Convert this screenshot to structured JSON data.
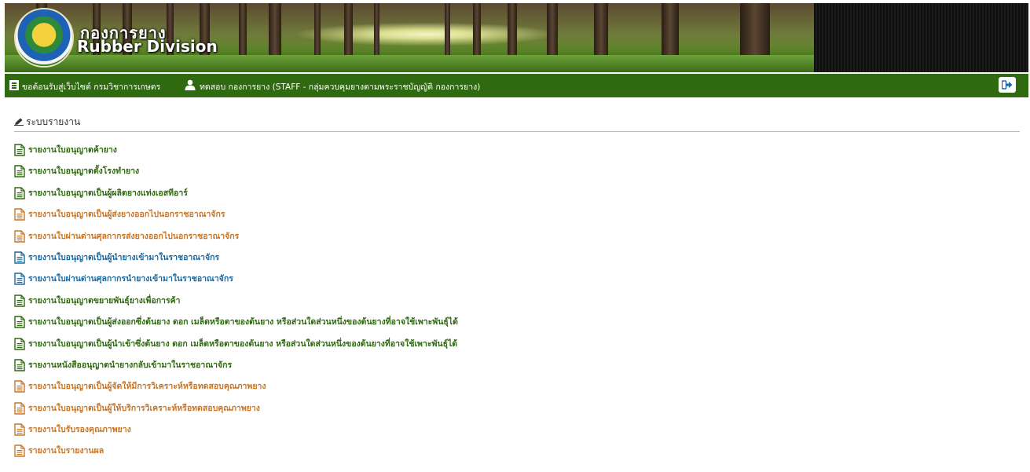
{
  "header": {
    "brand_th": "กองการยาง",
    "brand_en": "Rubber Division"
  },
  "userbar": {
    "welcome": "ขอต้อนรับสู่เว็บไซต์ กรมวิชาการเกษตร",
    "user": "ทดสอบ กองการยาง (STAFF - กลุ่มควบคุมยางตามพระราชบัญญัติ กองการยาง)",
    "icons": [
      "list-icon",
      "user-icon",
      "logout-icon"
    ]
  },
  "panel": {
    "title": "ระบบรายงาน",
    "icon": "pencil-icon"
  },
  "reports": [
    {
      "label": "รายงานใบอนุญาตค้ายาง",
      "color": "#2f6a10"
    },
    {
      "label": "รายงานใบอนุญาตตั้งโรงทำยาง",
      "color": "#2f6a10"
    },
    {
      "label": "รายงานใบอนุญาตเป็นผู้ผลิตยางแท่งเอสทีอาร์",
      "color": "#2f6a10"
    },
    {
      "label": "รายงานใบอนุญาตเป็นผู้ส่งยางออกไปนอกราชอาณาจักร",
      "color": "#c8772a"
    },
    {
      "label": "รายงานใบผ่านด่านศุลกากรส่งยางออกไปนอกราชอาณาจักร",
      "color": "#c8772a"
    },
    {
      "label": "รายงานใบอนุญาตเป็นผู้นำยางเข้ามาในราชอาณาจักร",
      "color": "#1c6aa0"
    },
    {
      "label": "รายงานใบผ่านด่านศุลกากรนำยางเข้ามาในราชอาณาจักร",
      "color": "#1c6aa0"
    },
    {
      "label": "รายงานใบอนุญาตขยายพันธุ์ยางเพื่อการค้า",
      "color": "#2f6a10"
    },
    {
      "label": "รายงานใบอนุญาตเป็นผู้ส่งออกซึ่งต้นยาง ดอก เมล็ดหรือตาของต้นยาง หรือส่วนใดส่วนหนึ่งของต้นยางที่อาจใช้เพาะพันธุ์ได้",
      "color": "#2f6a10"
    },
    {
      "label": "รายงานใบอนุญาตเป็นผู้นำเข้าซึ่งต้นยาง ดอก เมล็ดหรือตาของต้นยาง หรือส่วนใดส่วนหนึ่งของต้นยางที่อาจใช้เพาะพันธุ์ได้",
      "color": "#2f6a10"
    },
    {
      "label": "รายงานหนังสืออนุญาตนำยางกลับเข้ามาในราชอาณาจักร",
      "color": "#2f6a10"
    },
    {
      "label": "รายงานใบอนุญาตเป็นผู้จัดให้มีการวิเคราะห์หรือทดสอบคุณภาพยาง",
      "color": "#c8772a"
    },
    {
      "label": "รายงานใบอนุญาตเป็นผู้ให้บริการวิเคราะห์หรือทดสอบคุณภาพยาง",
      "color": "#c8772a"
    },
    {
      "label": "รายงานใบรับรองคุณภาพยาง",
      "color": "#c8772a"
    },
    {
      "label": "รายงานใบรายงานผล",
      "color": "#c8772a"
    }
  ]
}
